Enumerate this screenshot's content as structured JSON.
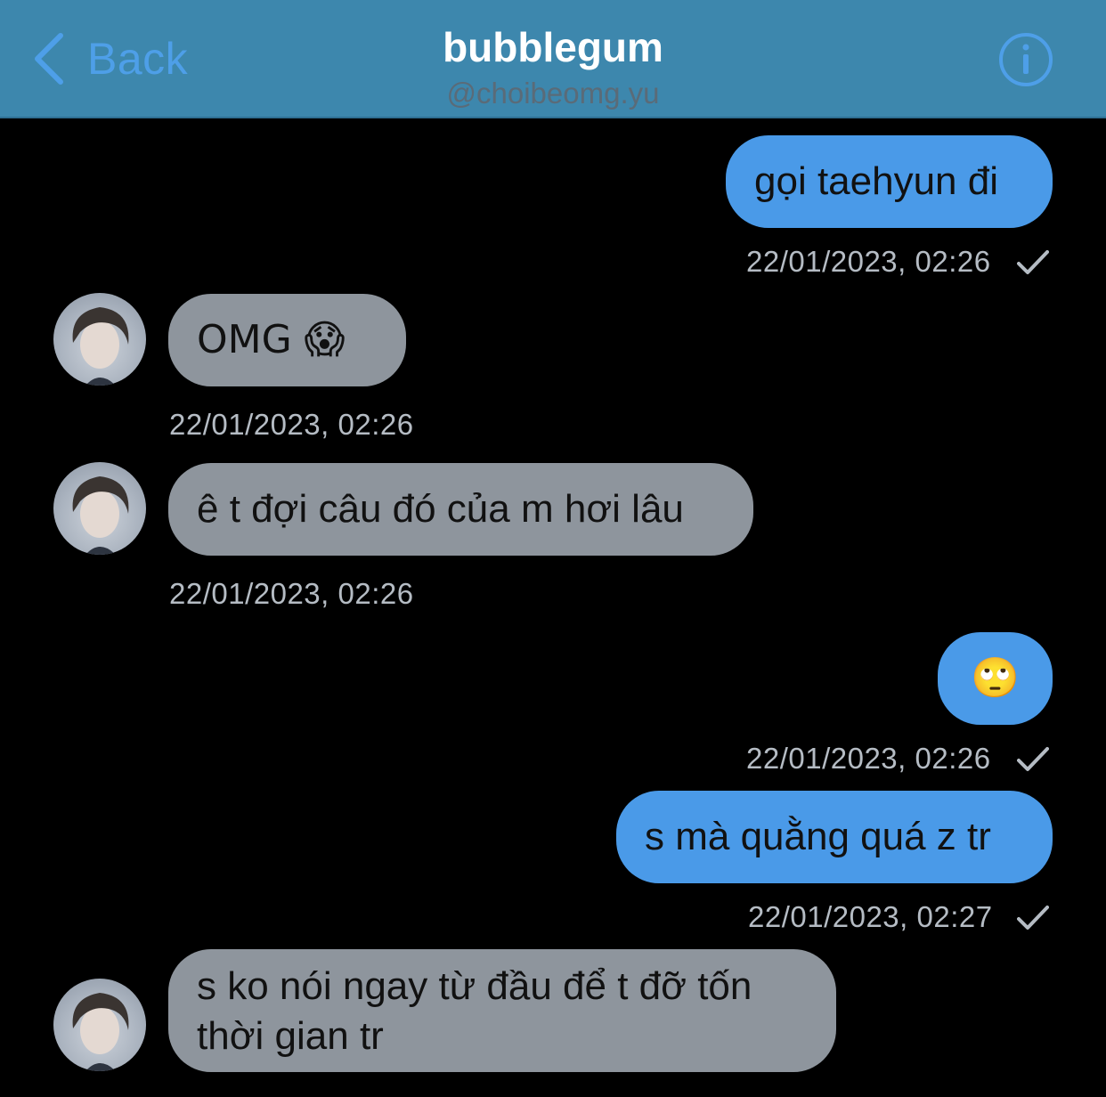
{
  "header": {
    "back_label": "Back",
    "title": "bubblegum",
    "subtitle": "@choibeomg.yu"
  },
  "messages": [
    {
      "direction": "outgoing",
      "text": "gọi taehyun đi",
      "timestamp": "22/01/2023, 02:26",
      "read": true
    },
    {
      "direction": "incoming",
      "text": "OMG 😱",
      "timestamp": "22/01/2023, 02:26"
    },
    {
      "direction": "incoming",
      "text": "ê t đợi câu đó của m hơi lâu",
      "timestamp": "22/01/2023, 02:26"
    },
    {
      "direction": "outgoing",
      "text": "🙄",
      "timestamp": "22/01/2023, 02:26",
      "read": true
    },
    {
      "direction": "outgoing",
      "text": "s mà quằng quá z tr",
      "timestamp": "22/01/2023, 02:27",
      "read": true
    },
    {
      "direction": "incoming",
      "text": "s ko nói ngay từ đầu để t đỡ tốn thời gian tr"
    }
  ],
  "colors": {
    "header_bg": "#3d87ad",
    "accent": "#4e9fe8",
    "outgoing_bubble": "#4a9ae8",
    "incoming_bubble": "#8e959d",
    "timestamp": "#b5bcc4",
    "background": "#000000"
  },
  "icons": {
    "back": "chevron-left-icon",
    "info": "info-circle-icon",
    "read": "checkmark-icon"
  }
}
